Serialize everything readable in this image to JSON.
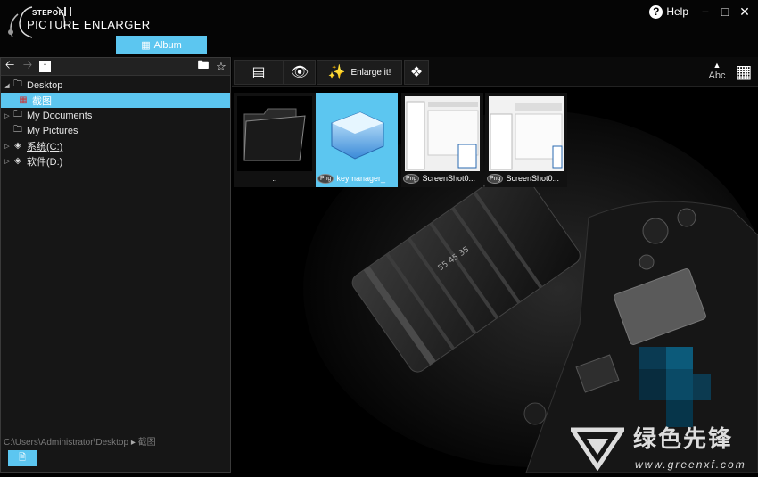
{
  "app": {
    "brand": "STEPOK",
    "name": "PICTURE ENLARGER"
  },
  "window": {
    "help_label": "Help",
    "minimize_glyph": "−",
    "maximize_glyph": "□",
    "close_glyph": "✕"
  },
  "album_button": {
    "label": "Album",
    "icon": "grid-icon"
  },
  "nav": {
    "back_icon": "arrow-left-icon",
    "forward_icon": "arrow-right-icon",
    "up_icon": "arrow-up-icon",
    "new_folder_icon": "new-folder-icon",
    "favorite_icon": "star-icon"
  },
  "tree": [
    {
      "label": "Desktop",
      "expander": "◢",
      "icon": "folder-icon",
      "level": 0,
      "selected": false
    },
    {
      "label": "截图",
      "expander": "",
      "icon": "image-folder-icon",
      "level": 1,
      "selected": true
    },
    {
      "label": "My Documents",
      "expander": "▷",
      "icon": "folder-icon",
      "level": 0,
      "selected": false
    },
    {
      "label": "My Pictures",
      "expander": "",
      "icon": "folder-icon",
      "level": 0,
      "selected": false
    },
    {
      "label": "系统(C:)",
      "expander": "▷",
      "icon": "drive-icon",
      "level": 0,
      "selected": false
    },
    {
      "label": "软件(D:)",
      "expander": "▷",
      "icon": "drive-icon",
      "level": 0,
      "selected": false
    }
  ],
  "path_bar": {
    "path": "C:\\Users\\Administrator\\Desktop",
    "separator": "▸",
    "current": "截图"
  },
  "bottom_button": {
    "icon": "document-icon"
  },
  "toolbar": {
    "list_icon": "list-icon",
    "preview_icon": "eye-icon",
    "enlarge_label": "Enlarge it!",
    "enlarge_icon": "magic-wand-icon",
    "batch_icon": "batch-icon",
    "sort_label": "Abc",
    "sort_icon": "sort-up-icon",
    "view_icon": "grid-view-icon"
  },
  "thumbnails": [
    {
      "caption": "..",
      "type": "folder",
      "badge": "",
      "selected": false
    },
    {
      "caption": "keymanager_",
      "type": "image",
      "badge": "Png",
      "selected": true
    },
    {
      "caption": "ScreenShot0...",
      "type": "screenshot",
      "badge": "Png",
      "selected": false
    },
    {
      "caption": "ScreenShot0...",
      "type": "screenshot",
      "badge": "Png",
      "selected": false
    }
  ],
  "watermark": {
    "text": "绿色先锋",
    "url": "www.greenxf.com"
  },
  "colors": {
    "accent": "#5cc6f0",
    "background": "#000000",
    "panel": "#161616"
  }
}
